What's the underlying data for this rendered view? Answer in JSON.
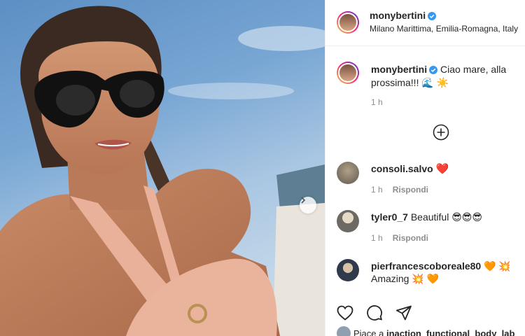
{
  "post": {
    "author": "monybertini",
    "location": "Milano Marittima, Emilia-Romagna, Italy",
    "caption": "Ciao mare, alla prossima!!! 🌊 ☀️",
    "caption_time": "1 h"
  },
  "comments": [
    {
      "user": "consoli.salvo",
      "text": "",
      "emoji": "❤️",
      "time": "1 h",
      "reply": "Rispondi"
    },
    {
      "user": "tyler0_7",
      "text": "Beautiful 😎😎😎",
      "time": "1 h",
      "reply": "Rispondi"
    },
    {
      "user": "pierfrancescoboreale80",
      "text": "🧡 💥",
      "text2": "Amazing 💥 🧡"
    }
  ],
  "likes": {
    "prefix": "Piace a ",
    "user": "inaction_functional_body_lab"
  },
  "icons": {
    "verified": "verified-badge-icon",
    "next": "chevron-right-icon",
    "load_more": "plus-circle-icon",
    "like": "heart-icon",
    "comment": "comment-bubble-icon",
    "share": "paper-plane-icon"
  },
  "colors": {
    "verified": "#3897f0",
    "text": "#262626",
    "muted": "#8e8e8e",
    "divider": "#efefef"
  }
}
